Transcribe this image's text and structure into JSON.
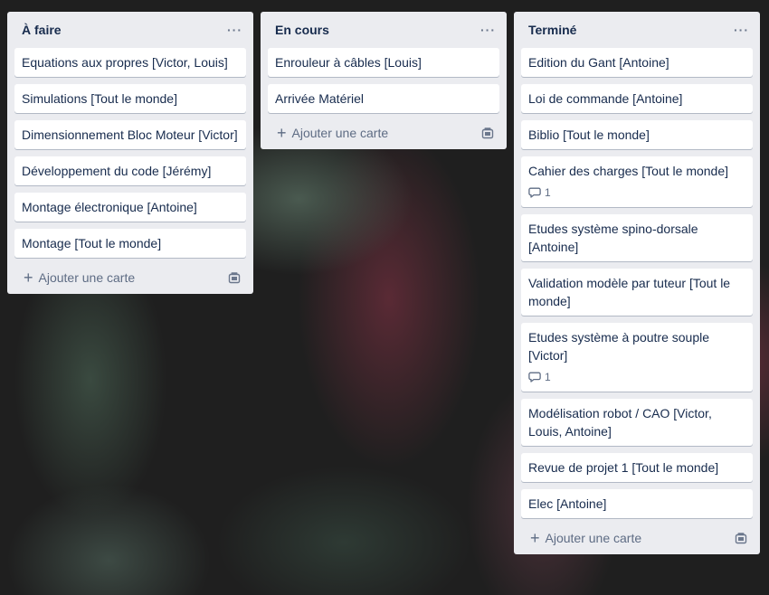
{
  "lists": [
    {
      "title": "À faire",
      "cards": [
        {
          "text": "Equations aux propres [Victor, Louis]"
        },
        {
          "text": "Simulations [Tout le monde]"
        },
        {
          "text": "Dimensionnement Bloc Moteur [Victor]"
        },
        {
          "text": "Développement du code [Jérémy]"
        },
        {
          "text": "Montage électronique [Antoine]"
        },
        {
          "text": "Montage [Tout le monde]"
        }
      ],
      "add_label": "Ajouter une carte"
    },
    {
      "title": "En cours",
      "cards": [
        {
          "text": "Enrouleur à câbles [Louis]"
        },
        {
          "text": "Arrivée Matériel"
        }
      ],
      "add_label": "Ajouter une carte"
    },
    {
      "title": "Terminé",
      "cards": [
        {
          "text": "Edition du Gant [Antoine]"
        },
        {
          "text": "Loi de commande [Antoine]"
        },
        {
          "text": "Biblio [Tout le monde]"
        },
        {
          "text": "Cahier des charges [Tout le monde]",
          "comments": "1"
        },
        {
          "text": "Etudes système spino-dorsale [Antoine]"
        },
        {
          "text": "Validation modèle par tuteur [Tout le monde]"
        },
        {
          "text": "Etudes système à poutre souple [Victor]",
          "comments": "1"
        },
        {
          "text": "Modélisation robot / CAO [Victor, Louis, Antoine]"
        },
        {
          "text": "Revue de projet 1 [Tout le monde]"
        },
        {
          "text": "Elec [Antoine]"
        }
      ],
      "add_label": "Ajouter une carte"
    }
  ],
  "icons": {
    "menu": "more-horizontal-icon",
    "add": "plus-icon",
    "template": "card-template-icon",
    "comment": "comment-icon"
  },
  "colors": {
    "list_bg": "#ebecf0",
    "card_bg": "#ffffff",
    "title_text": "#172b4d",
    "muted_text": "#5e6c84"
  }
}
